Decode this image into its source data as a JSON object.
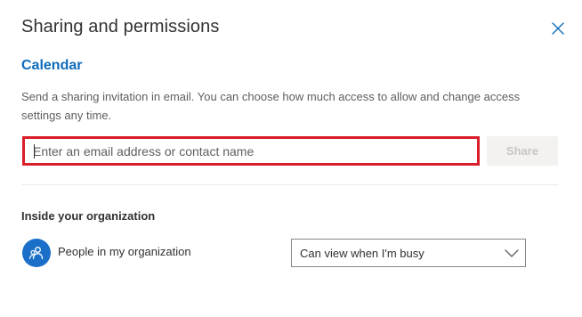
{
  "dialog": {
    "title": "Sharing and permissions",
    "close_icon": "close-icon"
  },
  "calendar": {
    "heading": "Calendar",
    "description": "Send a sharing invitation in email. You can choose how much access to allow and change access settings any time."
  },
  "invite": {
    "email_value": "",
    "email_placeholder": "Enter an email address or contact name",
    "share_label": "Share",
    "share_enabled": false
  },
  "organization": {
    "heading": "Inside your organization",
    "members": [
      {
        "icon": "people-icon",
        "name": "People in my organization",
        "permission": "Can view when I'm busy",
        "dropdown_icon": "chevron-down-icon"
      }
    ]
  },
  "colors": {
    "accent": "#0f6cbd",
    "highlight_border": "#d91d29",
    "avatar_bg": "#1a6fc9",
    "disabled_button_bg": "#f3f2f1"
  }
}
